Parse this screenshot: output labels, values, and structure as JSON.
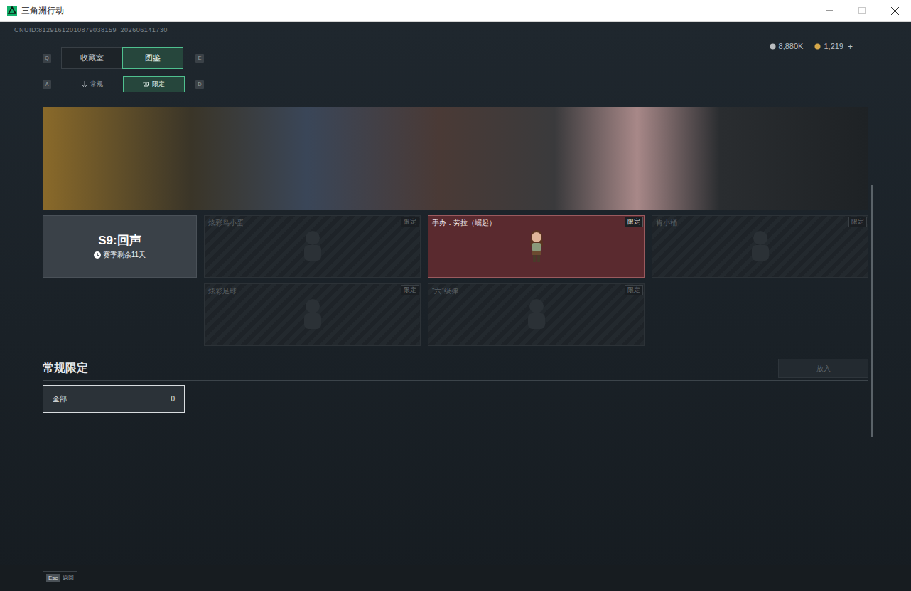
{
  "window": {
    "title": "三角洲行动"
  },
  "uid": "CNUID:81291612010879038159_202606141730",
  "currency": [
    {
      "amount": "8,880K",
      "color": "#b9bcbf"
    },
    {
      "amount": "1,219",
      "color": "#d6a84a"
    }
  ],
  "add_button": "+",
  "main_tabs": {
    "prev_key": "Q",
    "next_key": "E",
    "items": [
      {
        "label": "收藏室",
        "selected": false
      },
      {
        "label": "图鉴",
        "selected": true
      }
    ]
  },
  "sub_tabs": {
    "prev_key": "A",
    "next_key": "D",
    "items": [
      {
        "label": "常规",
        "selected": false
      },
      {
        "label": "限定",
        "selected": true
      }
    ]
  },
  "season": {
    "title": "S9:回声",
    "remaining": "赛季剩余11天"
  },
  "items": [
    {
      "name": "炫彩鸟小蛋",
      "badge": "限定",
      "owned": false
    },
    {
      "name": "手办：劳拉（崛起）",
      "badge": "限定",
      "owned": true
    },
    {
      "name": "肯小桶",
      "badge": "限定",
      "owned": false
    },
    {
      "name": "炫彩足球",
      "badge": "限定",
      "owned": false
    },
    {
      "name": "“六”级弹",
      "badge": "限定",
      "owned": false
    }
  ],
  "section": {
    "title": "常规限定",
    "button": {
      "label": "放入",
      "disabled": true
    }
  },
  "filters": [
    {
      "label": "全部",
      "count": "0",
      "selected": true
    }
  ],
  "footer": {
    "key": "Esc",
    "label": "返回"
  }
}
